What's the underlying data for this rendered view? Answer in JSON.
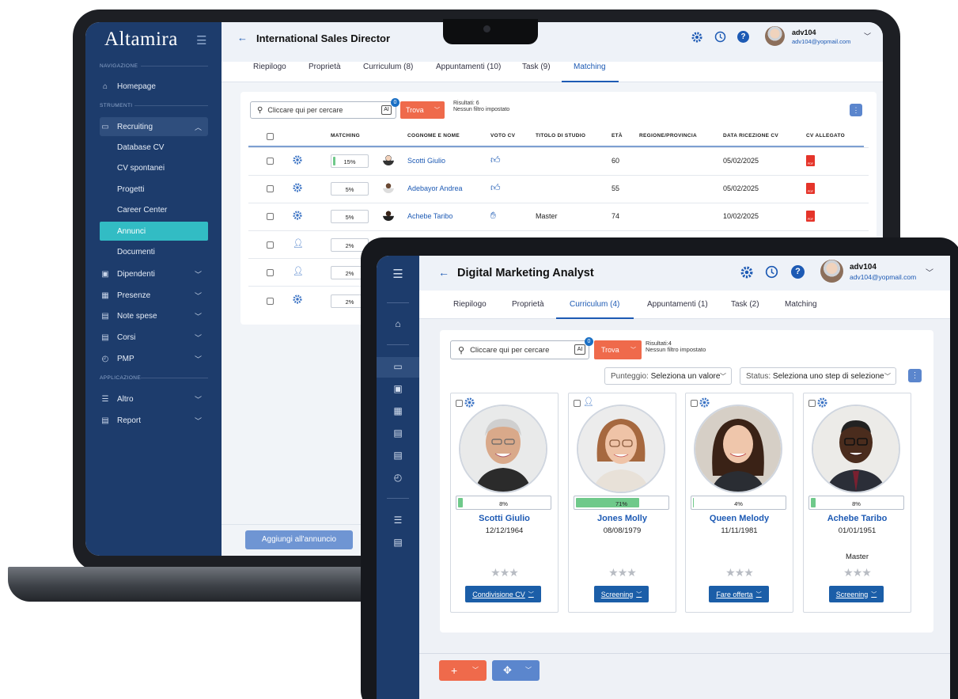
{
  "laptop": {
    "sidebar": {
      "logo": "Altamira",
      "section_nav": "NAVIGAZIONE",
      "section_tools": "STRUMENTI",
      "section_apps": "APPLICAZIONE",
      "items": {
        "homepage": "Homepage",
        "recruiting": "Recruiting",
        "database_cv": "Database CV",
        "cv_spontanei": "CV spontanei",
        "progetti": "Progetti",
        "career_center": "Career Center",
        "annunci": "Annunci",
        "documenti": "Documenti",
        "dipendenti": "Dipendenti",
        "presenze": "Presenze",
        "note_spese": "Note spese",
        "corsi": "Corsi",
        "pmp": "PMP",
        "altro": "Altro",
        "report": "Report"
      }
    },
    "header": {
      "title": "International Sales Director",
      "user_name": "adv104",
      "user_email": "adv104@yopmail.com"
    },
    "tabs": [
      "Riepilogo",
      "Proprietà",
      "Curriculum (8)",
      "Appuntamenti (10)",
      "Task (9)",
      "Matching"
    ],
    "active_tab": "Matching",
    "search": {
      "placeholder": "Cliccare qui per cercare",
      "ai_label": "AI",
      "ai_badge": "0",
      "button": "Trova",
      "results": "Risultati: 6",
      "filter": "Nessun filtro impostato"
    },
    "table": {
      "headers": {
        "matching": "MATCHING",
        "name": "COGNOME E NOME",
        "voto": "VOTO CV",
        "titolo": "TITOLO DI STUDIO",
        "eta": "ETÀ",
        "regione": "REGIONE/PROVINCIA",
        "data": "DATA RICEZIONE CV",
        "allegato": "CV ALLEGATO"
      },
      "rows": [
        {
          "matching": "15%",
          "matching_value": 0.15,
          "name": "Scotti Giulio",
          "voto": "thumbs-up-icon",
          "titolo": "",
          "eta": "60",
          "data": "05/02/2025",
          "pdf": "PDF"
        },
        {
          "matching": "5%",
          "matching_value": 0.05,
          "name": "Adebayor Andrea",
          "voto": "thumbs-up-icon",
          "titolo": "",
          "eta": "55",
          "data": "05/02/2025",
          "pdf": "PDF"
        },
        {
          "matching": "5%",
          "matching_value": 0.05,
          "name": "Achebe Taribo",
          "voto": "hand-icon",
          "titolo": "Master",
          "eta": "74",
          "data": "10/02/2025",
          "pdf": "PDF"
        },
        {
          "matching": "2%",
          "matching_value": 0.02
        },
        {
          "matching": "2%",
          "matching_value": 0.02
        },
        {
          "matching": "2%",
          "matching_value": 0.02
        }
      ]
    },
    "footer": {
      "add_button": "Aggiungi all'annuncio"
    }
  },
  "tablet": {
    "header": {
      "title": "Digital Marketing Analyst",
      "user_name": "adv104",
      "user_email": "adv104@yopmail.com"
    },
    "tabs": [
      "Riepilogo",
      "Proprietà",
      "Curriculum (4)",
      "Appuntamenti (1)",
      "Task (2)",
      "Matching"
    ],
    "active_tab": "Curriculum (4)",
    "search": {
      "placeholder": "Cliccare qui per cercare",
      "ai_label": "AI",
      "ai_badge": "0",
      "button": "Trova",
      "results": "Risultati:4",
      "filter": "Nessun filtro impostato"
    },
    "filters": {
      "punteggio_label": "Punteggio:",
      "punteggio_value": "Seleziona un valore",
      "status_label": "Status:",
      "status_value": "Seleziona uno step di selezione"
    },
    "cards": [
      {
        "pct": "8%",
        "pct_value": 0.08,
        "name": "Scotti Giulio",
        "date": "12/12/1964",
        "master": "",
        "button": "Condivisione CV",
        "type_icon": "gear-icon"
      },
      {
        "pct": "71%",
        "pct_value": 0.71,
        "name": "Jones Molly",
        "date": "08/08/1979",
        "master": "",
        "button": "Screening",
        "type_icon": "user-icon"
      },
      {
        "pct": "4%",
        "pct_value": 0.04,
        "name": "Queen Melody",
        "date": "11/11/1981",
        "master": "",
        "button": "Fare offerta",
        "type_icon": "gear-icon"
      },
      {
        "pct": "8%",
        "pct_value": 0.08,
        "name": "Achebe Taribo",
        "date": "01/01/1951",
        "master": "Master",
        "button": "Screening",
        "type_icon": "gear-icon"
      }
    ],
    "footer": {
      "add": "+",
      "move": "✥"
    }
  },
  "colors": {
    "sidebar": "#1d3c6c",
    "accent_teal": "#32bcc4",
    "link_blue": "#1d5ab4",
    "action_orange": "#ef6a4b",
    "button_blue": "#1b5ea8",
    "match_green": "#6fc98a"
  }
}
